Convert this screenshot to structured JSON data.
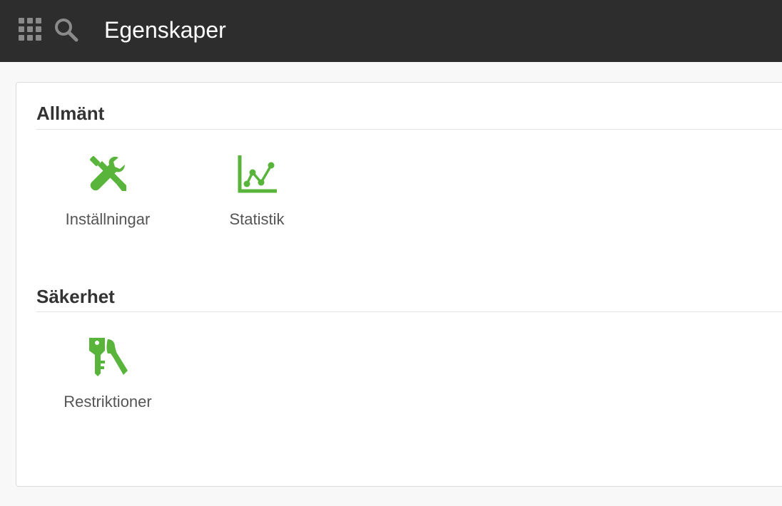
{
  "header": {
    "title": "Egenskaper",
    "apps_icon": "grid-icon",
    "search_icon": "search-icon"
  },
  "colors": {
    "topbar": "#2d2d2d",
    "accent_green": "#58b43a",
    "heading": "#333333",
    "label": "#555555"
  },
  "sections": [
    {
      "heading": "Allmänt",
      "items": [
        {
          "label": "Inställningar",
          "icon": "tools-icon"
        },
        {
          "label": "Statistik",
          "icon": "line-chart-icon"
        }
      ]
    },
    {
      "heading": "Säkerhet",
      "items": [
        {
          "label": "Restriktioner",
          "icon": "key-icon"
        }
      ]
    }
  ]
}
